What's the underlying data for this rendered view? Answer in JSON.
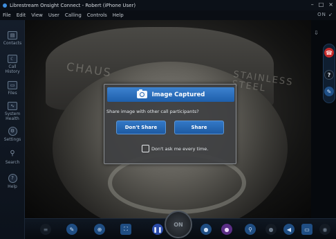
{
  "window": {
    "title": "Librestream Onsight Connect - Robert (iPhone User)",
    "controls": [
      "–",
      "□",
      "×"
    ]
  },
  "menu": {
    "items": [
      {
        "label": "File"
      },
      {
        "label": "Edit"
      },
      {
        "label": "View"
      },
      {
        "label": "User"
      },
      {
        "label": "Calling"
      },
      {
        "label": "Controls"
      },
      {
        "label": "Help"
      }
    ],
    "right_indicator": "ON ↙"
  },
  "sidebar": {
    "items": [
      {
        "label": "Contacts",
        "icon": "contacts-icon"
      },
      {
        "label": "Call History",
        "icon": "call-history-icon"
      },
      {
        "label": "Files",
        "icon": "files-icon"
      },
      {
        "label": "System Health",
        "icon": "system-health-icon"
      },
      {
        "label": "Settings",
        "icon": "settings-icon"
      },
      {
        "label": "Search",
        "icon": "search-icon"
      },
      {
        "label": "Help",
        "icon": "help-icon"
      }
    ]
  },
  "camera_view": {
    "engraving_left": "CHAUS",
    "engraving_right": "STAINLESS\nSTEEL"
  },
  "right_controls": {
    "end_call_icon": "end-call-icon",
    "help_icon": "help-icon",
    "share_icon": "share-icon"
  },
  "toolbar": {
    "center_label": "ON"
  },
  "dialog": {
    "title": "Image Captured",
    "message": "Share image with other call participants?",
    "dont_share_label": "Don't Share",
    "share_label": "Share",
    "checkbox_label": "Don't ask me every time.",
    "checkbox_checked": false
  }
}
